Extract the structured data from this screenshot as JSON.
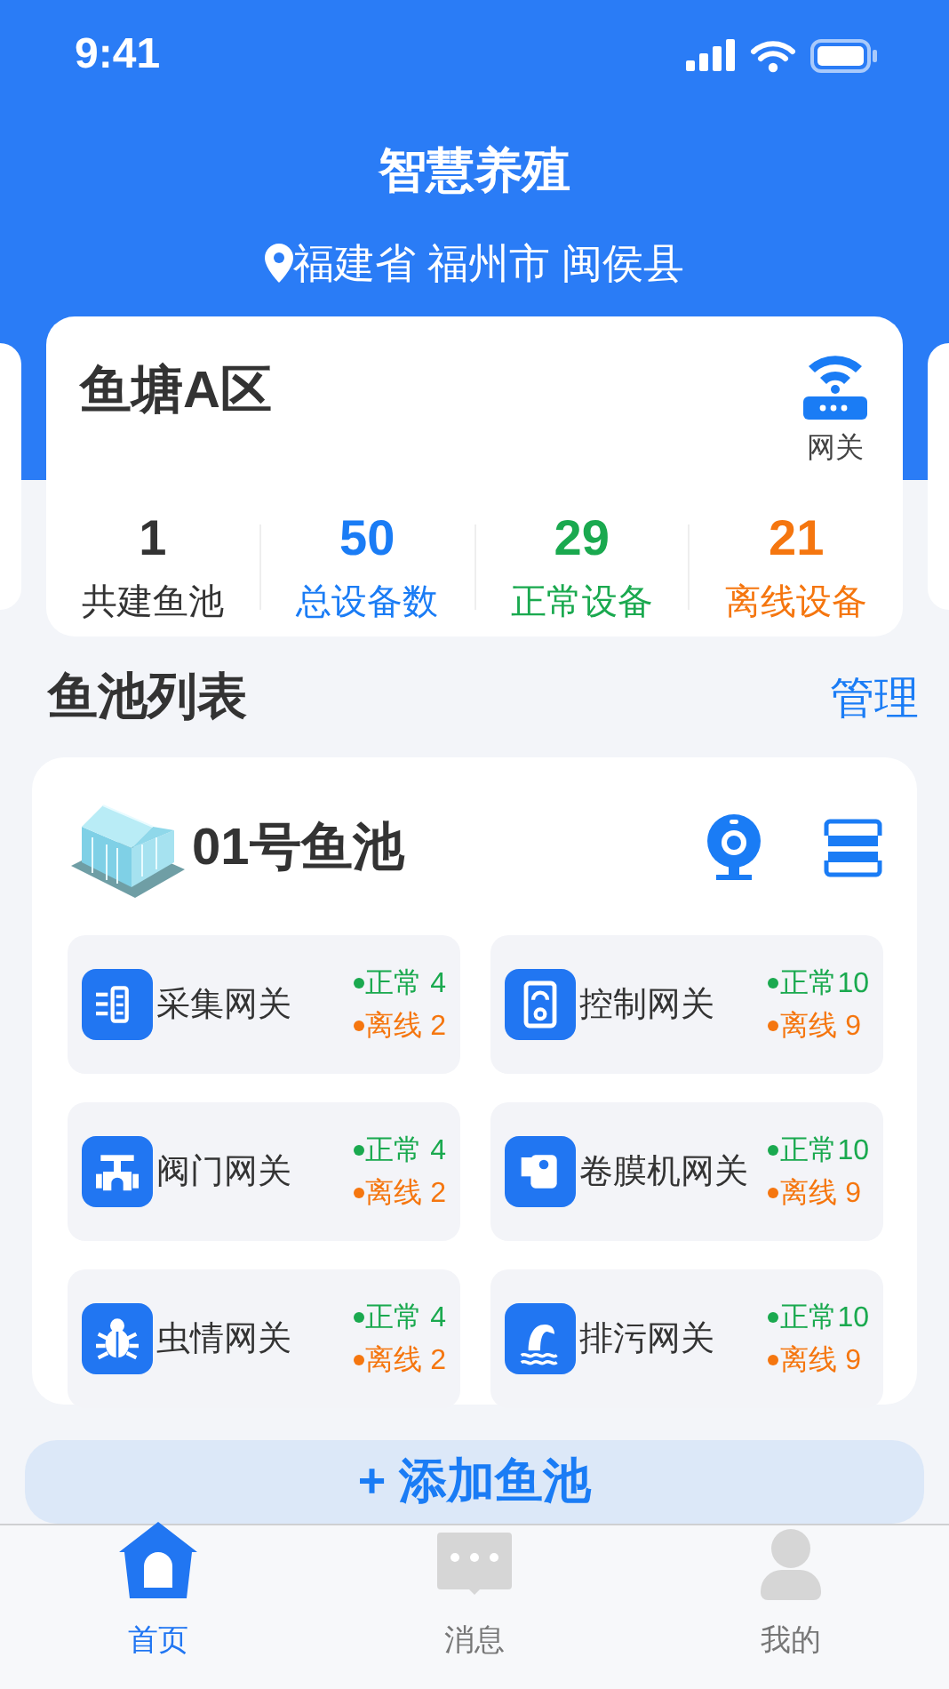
{
  "status_bar": {
    "time": "9:41"
  },
  "header": {
    "title": "智慧养殖",
    "location": "福建省 福州市 闽侯县"
  },
  "area": {
    "name": "鱼塘A区",
    "gateway_label": "网关",
    "stats": [
      {
        "value": "1",
        "label": "共建鱼池",
        "color": "#333333"
      },
      {
        "value": "50",
        "label": "总设备数",
        "color": "#1a7cf5"
      },
      {
        "value": "29",
        "label": "正常设备",
        "color": "#1aa94f"
      },
      {
        "value": "21",
        "label": "离线设备",
        "color": "#f5760f"
      }
    ]
  },
  "section": {
    "title": "鱼池列表",
    "action": "管理"
  },
  "pond": {
    "name": "01号鱼池",
    "gateways": [
      {
        "name": "采集网关",
        "normal": "正常 4",
        "offline": "离线 2"
      },
      {
        "name": "控制网关",
        "normal": "正常10",
        "offline": "离线 9"
      },
      {
        "name": "阀门网关",
        "normal": "正常 4",
        "offline": "离线 2"
      },
      {
        "name": "卷膜机网关",
        "normal": "正常10",
        "offline": "离线 9"
      },
      {
        "name": "虫情网关",
        "normal": "正常 4",
        "offline": "离线 2"
      },
      {
        "name": "排污网关",
        "normal": "正常10",
        "offline": "离线 9"
      }
    ]
  },
  "add_button": {
    "label": "+ 添加鱼池"
  },
  "tabs": [
    {
      "label": "首页",
      "selected": true
    },
    {
      "label": "消息",
      "selected": false
    },
    {
      "label": "我的",
      "selected": false
    }
  ]
}
